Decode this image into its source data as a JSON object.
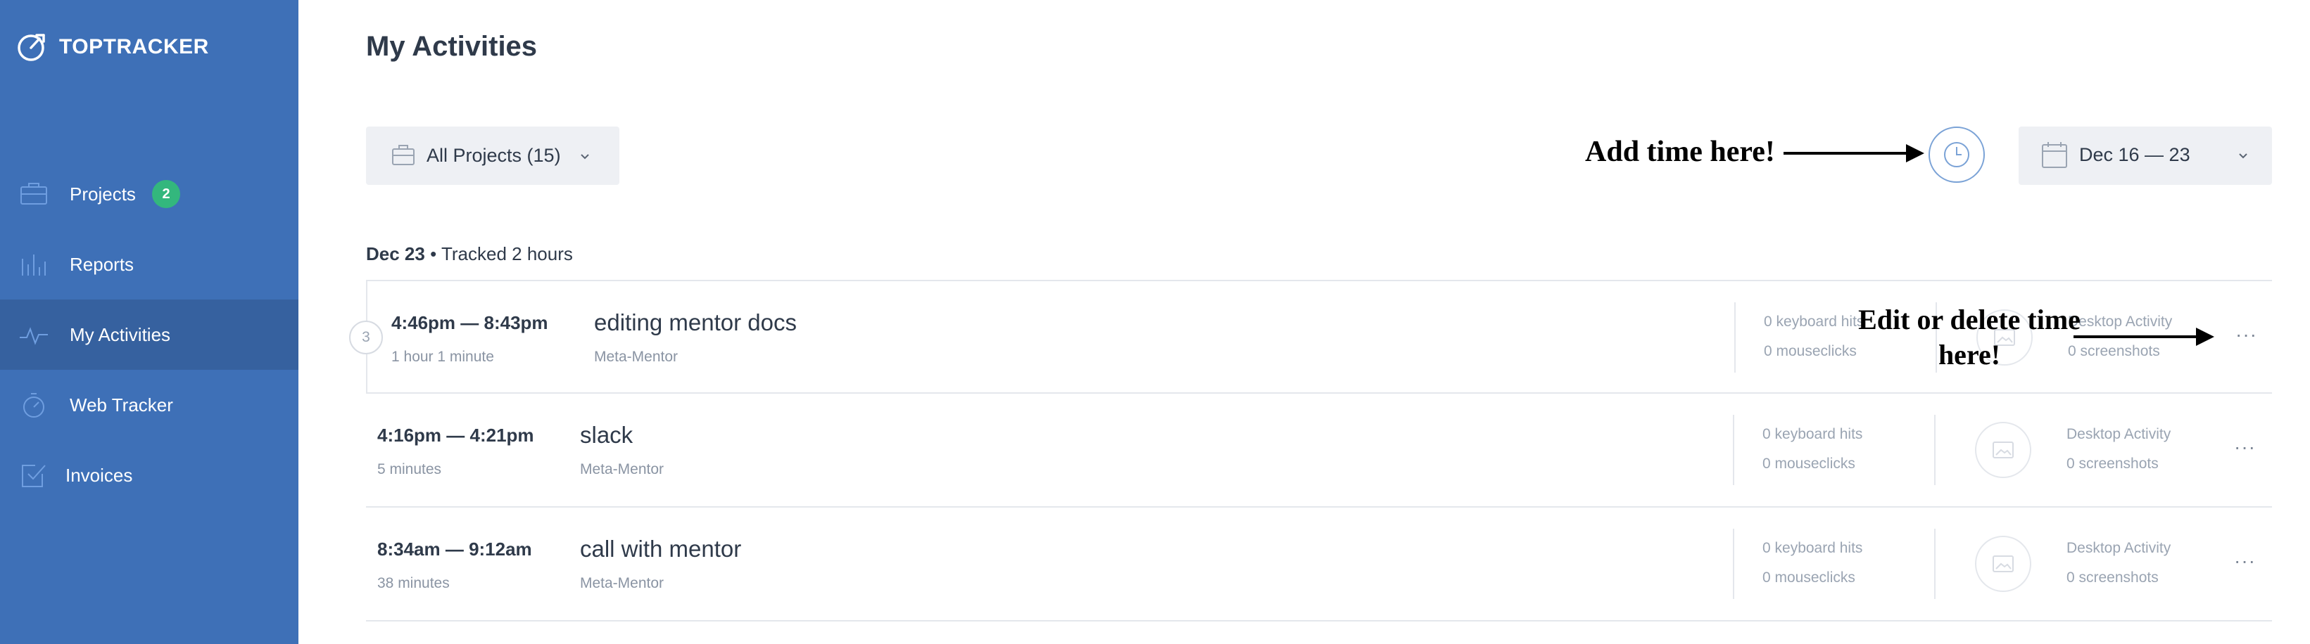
{
  "sidebar": {
    "brand": "TOPTRACKER",
    "items": [
      {
        "label": "Projects",
        "icon": "briefcase-icon",
        "badge": "2",
        "active": false
      },
      {
        "label": "Reports",
        "icon": "bar-chart-icon",
        "active": false
      },
      {
        "label": "My Activities",
        "icon": "pulse-icon",
        "active": true
      },
      {
        "label": "Web Tracker",
        "icon": "stopwatch-icon",
        "active": false
      },
      {
        "label": "Invoices",
        "icon": "invoice-check-icon",
        "active": false
      }
    ]
  },
  "main": {
    "title": "My Activities",
    "project_filter": {
      "label": "All Projects (15)",
      "icon": "briefcase-icon"
    },
    "add_time": {
      "icon": "clock-icon"
    },
    "date_range": {
      "label": "Dec 16 — 23",
      "icon": "calendar-icon"
    },
    "day": {
      "date": "Dec 23",
      "separator": "•",
      "summary": "Tracked 2 hours"
    },
    "activities": [
      {
        "group_count": "3",
        "time": "4:46pm — 8:43pm",
        "duration": "1 hour 1 minute",
        "task": "editing mentor docs",
        "project": "Meta-Mentor",
        "keyboard": "0 keyboard hits",
        "mouse": "0 mouseclicks",
        "desktop": "Desktop Activity",
        "screenshots": "0 screenshots",
        "more": "···"
      },
      {
        "time": "4:16pm — 4:21pm",
        "duration": "5 minutes",
        "task": "slack",
        "project": "Meta-Mentor",
        "keyboard": "0 keyboard hits",
        "mouse": "0 mouseclicks",
        "desktop": "Desktop Activity",
        "screenshots": "0 screenshots",
        "more": "···"
      },
      {
        "time": "8:34am — 9:12am",
        "duration": "38 minutes",
        "task": "call with mentor",
        "project": "Meta-Mentor",
        "keyboard": "0 keyboard hits",
        "mouse": "0 mouseclicks",
        "desktop": "Desktop Activity",
        "screenshots": "0 screenshots",
        "more": "···"
      }
    ]
  },
  "annotations": {
    "add_time": "Add time here!",
    "edit_delete": "Edit or delete time here!"
  },
  "colors": {
    "sidebar": "#3e70b7",
    "sidebar_active": "#36619f",
    "badge": "#33b77d",
    "filter_bg": "#eef0f4",
    "accent": "#7aa2d6"
  }
}
